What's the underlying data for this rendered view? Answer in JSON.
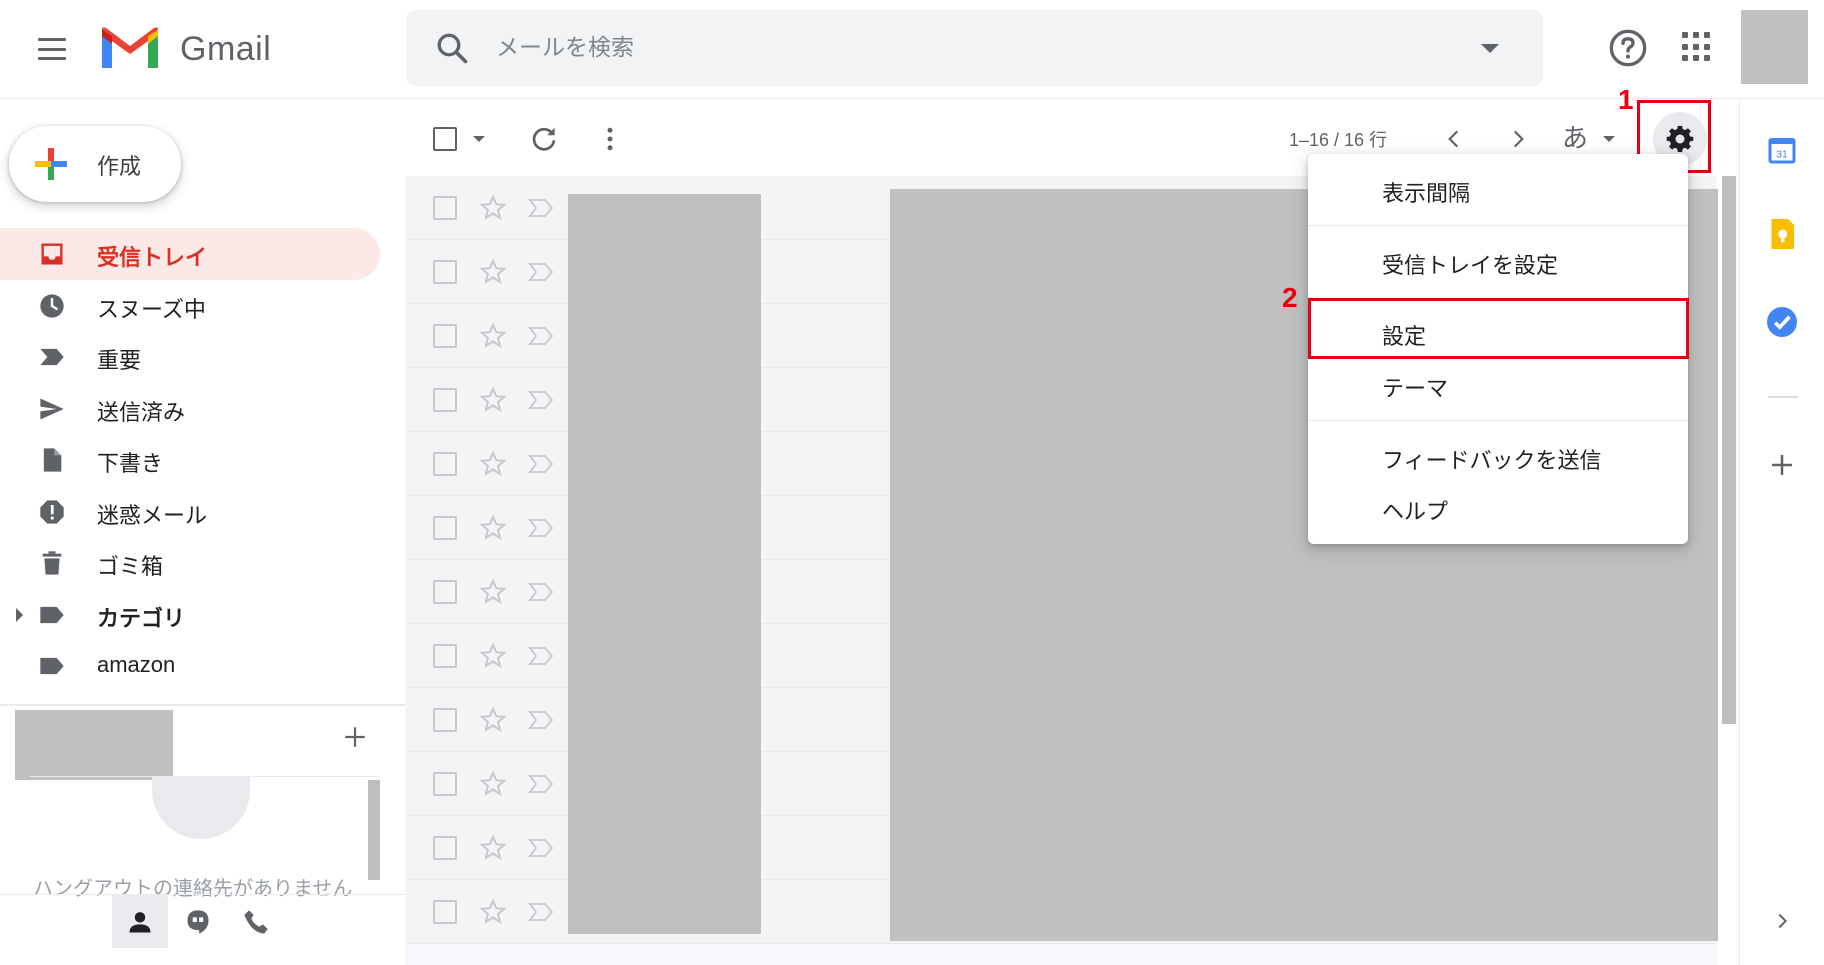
{
  "header": {
    "app_name": "Gmail",
    "search_placeholder": "メールを検索"
  },
  "compose": {
    "label": "作成"
  },
  "nav": {
    "items": [
      {
        "label": "受信トレイ",
        "icon": "inbox-icon",
        "active": true
      },
      {
        "label": "スヌーズ中",
        "icon": "clock-icon"
      },
      {
        "label": "重要",
        "icon": "important-icon"
      },
      {
        "label": "送信済み",
        "icon": "send-icon"
      },
      {
        "label": "下書き",
        "icon": "draft-icon"
      },
      {
        "label": "迷惑メール",
        "icon": "spam-icon"
      },
      {
        "label": "ゴミ箱",
        "icon": "trash-icon"
      },
      {
        "label": "カテゴリ",
        "icon": "label-icon",
        "bold": true,
        "expandable": true
      },
      {
        "label": "amazon",
        "icon": "label-icon"
      }
    ]
  },
  "hangouts": {
    "empty_text": "ハングアウトの連絡先がありません"
  },
  "toolbar": {
    "pagination": "1–16 / 16 行",
    "input_tool": "あ"
  },
  "settings_menu": {
    "items": [
      "表示間隔",
      "受信トレイを設定",
      "設定",
      "テーマ",
      "フィードバックを送信",
      "ヘルプ"
    ]
  },
  "callouts": {
    "step1": "1",
    "step2": "2"
  },
  "list": {
    "row_count": 12
  },
  "colors": {
    "accent_red": "#d93025",
    "highlight_red": "#e60012",
    "active_bg": "#fce8e6",
    "redaction_gray": "#c0c0c0"
  }
}
